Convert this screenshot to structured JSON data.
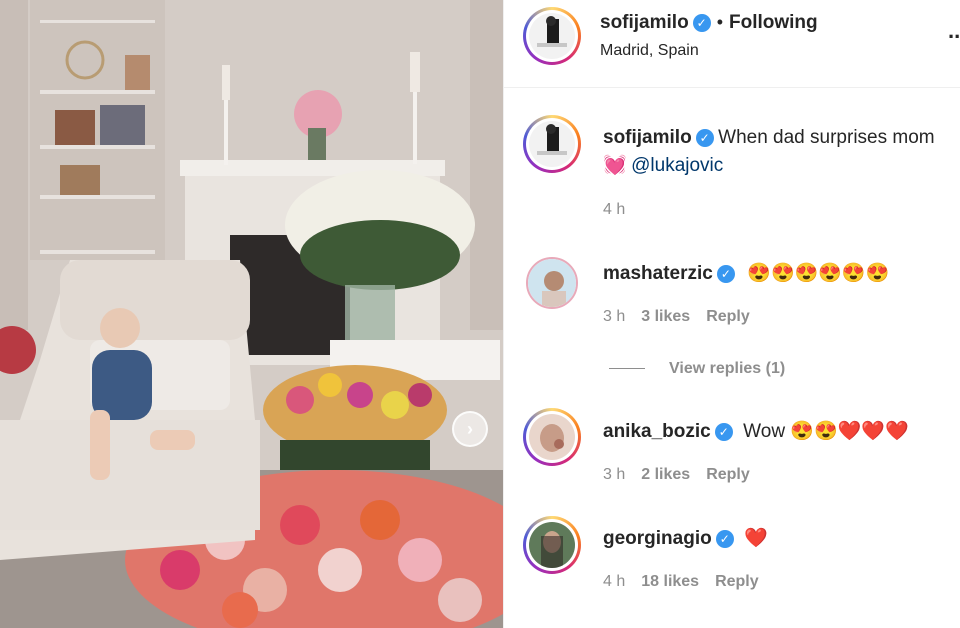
{
  "post": {
    "username": "sofijamilo",
    "location": "Madrid, Spain",
    "separator": "•",
    "follow_status": "Following",
    "more_glyph": "..."
  },
  "caption": {
    "username": "sofijamilo",
    "text": "When dad surprises mom",
    "emoji": "💓",
    "mention": "@lukajovic",
    "time": "4 h"
  },
  "comments": [
    {
      "username": "mashaterzic",
      "text": "😍😍😍😍😍😍",
      "time": "3 h",
      "likes": "3 likes",
      "reply": "Reply"
    },
    {
      "username": "anika_bozic",
      "text": "Wow 😍😍❤️❤️❤️",
      "time": "3 h",
      "likes": "2 likes",
      "reply": "Reply"
    },
    {
      "username": "georginagio",
      "text": "❤️",
      "time": "4 h",
      "likes": "18 likes",
      "reply": "Reply"
    }
  ],
  "view_replies": "View replies (1)",
  "icons": {
    "verified": "verified-badge-icon",
    "next": "chevron-right-icon",
    "more": "more-options-icon"
  },
  "colors": {
    "verified_blue": "#3897f0",
    "mention": "#00376b",
    "muted": "#8e8e8e",
    "story_ring": "#d62976"
  }
}
